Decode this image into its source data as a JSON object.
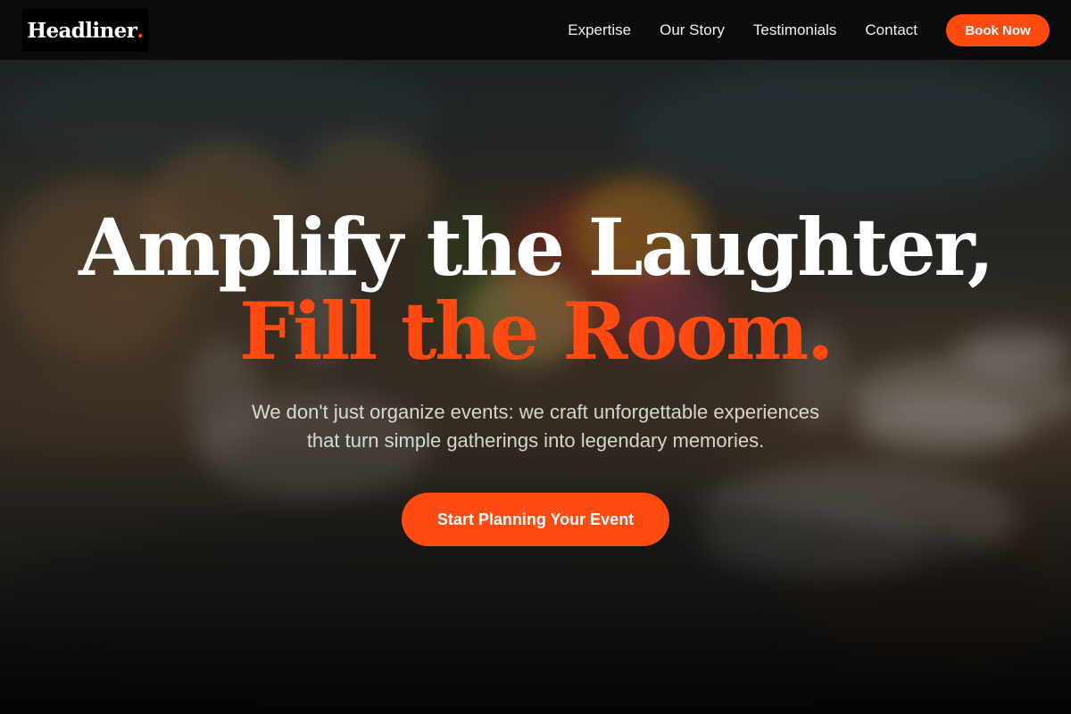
{
  "brand": {
    "logo_text": "Headliner",
    "logo_dot": ".",
    "accent_color": "#ff4a12"
  },
  "nav": {
    "links": [
      {
        "label": "Expertise"
      },
      {
        "label": "Our Story"
      },
      {
        "label": "Testimonials"
      },
      {
        "label": "Contact"
      }
    ],
    "cta_label": "Book Now"
  },
  "hero": {
    "headline_line1": "Amplify the Laughter,",
    "headline_line2": "Fill the Room.",
    "subtext": "We don't just organize events: we craft unforgettable experiences that turn simple gatherings into legendary memories.",
    "cta_label": "Start Planning Your Event"
  }
}
